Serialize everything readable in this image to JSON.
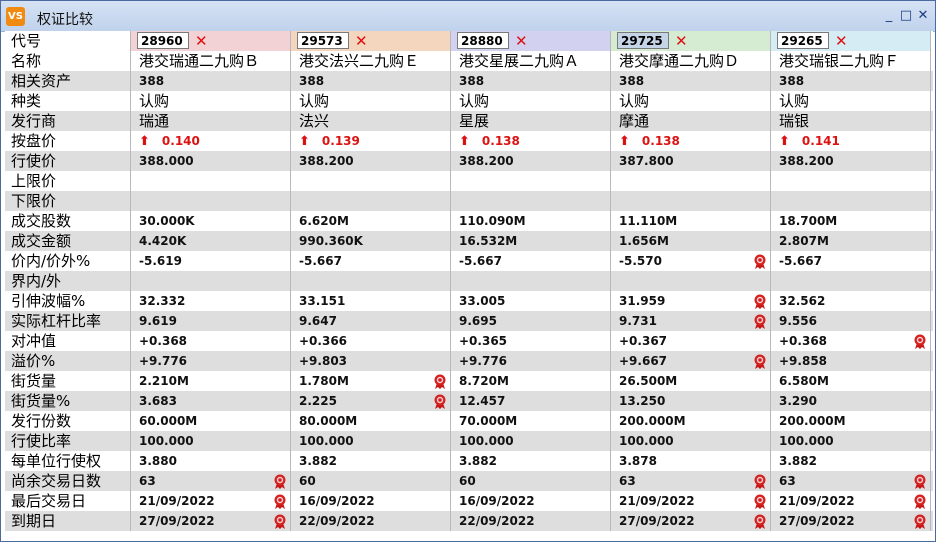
{
  "window": {
    "title": "权证比较",
    "app_icon": "VS",
    "btn_min": "_",
    "btn_max": "□",
    "btn_close": "✕"
  },
  "rows": [
    {
      "label": "代号",
      "kind": "code",
      "values": [
        "28960",
        "29573",
        "28880",
        "29725",
        "29265"
      ]
    },
    {
      "label": "名称",
      "kind": "cjk",
      "values": [
        "港交瑞通二九购Ｂ",
        "港交法兴二九购Ｅ",
        "港交星展二九购Ａ",
        "港交摩通二九购Ｄ",
        "港交瑞银二九购Ｆ"
      ]
    },
    {
      "label": "相关资产",
      "kind": "val",
      "values": [
        "388",
        "388",
        "388",
        "388",
        "388"
      ]
    },
    {
      "label": "种类",
      "kind": "cjk",
      "values": [
        "认购",
        "认购",
        "认购",
        "认购",
        "认购"
      ]
    },
    {
      "label": "发行商",
      "kind": "cjk",
      "values": [
        "瑞通",
        "法兴",
        "星展",
        "摩通",
        "瑞银"
      ]
    },
    {
      "label": "按盘价",
      "kind": "price",
      "values": [
        "0.140",
        "0.139",
        "0.138",
        "0.138",
        "0.141"
      ]
    },
    {
      "label": "行使价",
      "kind": "val",
      "values": [
        "388.000",
        "388.200",
        "388.200",
        "387.800",
        "388.200"
      ]
    },
    {
      "label": "上限价",
      "kind": "val",
      "values": [
        "",
        "",
        "",
        "",
        ""
      ]
    },
    {
      "label": "下限价",
      "kind": "val",
      "values": [
        "",
        "",
        "",
        "",
        ""
      ]
    },
    {
      "label": "成交股数",
      "kind": "val",
      "values": [
        "30.000K",
        "6.620M",
        "110.090M",
        "11.110M",
        "18.700M"
      ]
    },
    {
      "label": "成交金额",
      "kind": "val",
      "values": [
        "4.420K",
        "990.360K",
        "16.532M",
        "1.656M",
        "2.807M"
      ]
    },
    {
      "label": "价内/价外%",
      "kind": "val",
      "values": [
        "-5.619",
        "-5.667",
        "-5.667",
        "-5.570",
        "-5.667"
      ],
      "badges": [
        3
      ]
    },
    {
      "label": "界内/外",
      "kind": "val",
      "values": [
        "",
        "",
        "",
        "",
        ""
      ]
    },
    {
      "label": "引伸波幅%",
      "kind": "val",
      "values": [
        "32.332",
        "33.151",
        "33.005",
        "31.959",
        "32.562"
      ],
      "badges": [
        3
      ]
    },
    {
      "label": "实际杠杆比率",
      "kind": "val",
      "values": [
        "9.619",
        "9.647",
        "9.695",
        "9.731",
        "9.556"
      ],
      "badges": [
        3
      ]
    },
    {
      "label": "对冲值",
      "kind": "val",
      "values": [
        "+0.368",
        "+0.366",
        "+0.365",
        "+0.367",
        "+0.368"
      ],
      "badges": [
        4
      ]
    },
    {
      "label": "溢价%",
      "kind": "val",
      "values": [
        "+9.776",
        "+9.803",
        "+9.776",
        "+9.667",
        "+9.858"
      ],
      "badges": [
        3
      ]
    },
    {
      "label": "街货量",
      "kind": "val",
      "values": [
        "2.210M",
        "1.780M",
        "8.720M",
        "26.500M",
        "6.580M"
      ],
      "badges": [
        1
      ]
    },
    {
      "label": "街货量%",
      "kind": "val",
      "values": [
        "3.683",
        "2.225",
        "12.457",
        "13.250",
        "3.290"
      ],
      "badges": [
        1
      ]
    },
    {
      "label": "发行份数",
      "kind": "val",
      "values": [
        "60.000M",
        "80.000M",
        "70.000M",
        "200.000M",
        "200.000M"
      ]
    },
    {
      "label": "行使比率",
      "kind": "val",
      "values": [
        "100.000",
        "100.000",
        "100.000",
        "100.000",
        "100.000"
      ]
    },
    {
      "label": "每单位行使权",
      "kind": "val",
      "values": [
        "3.880",
        "3.882",
        "3.882",
        "3.878",
        "3.882"
      ]
    },
    {
      "label": "尚余交易日数",
      "kind": "val",
      "values": [
        "63",
        "60",
        "60",
        "63",
        "63"
      ],
      "badges": [
        0,
        3,
        4
      ]
    },
    {
      "label": "最后交易日",
      "kind": "val",
      "values": [
        "21/09/2022",
        "16/09/2022",
        "16/09/2022",
        "21/09/2022",
        "21/09/2022"
      ],
      "badges": [
        0,
        3,
        4
      ]
    },
    {
      "label": "到期日",
      "kind": "val",
      "values": [
        "27/09/2022",
        "22/09/2022",
        "22/09/2022",
        "27/09/2022",
        "27/09/2022"
      ],
      "badges": [
        0,
        3,
        4
      ]
    }
  ],
  "code_colors": [
    "#f2d2d4",
    "#f4d5be",
    "#d2d2f0",
    "#d6ecd2",
    "#d6ecf4"
  ],
  "selected_code_index": 3,
  "icons": {
    "up": "up-arrow-icon",
    "clear": "clear-x-icon",
    "best": "award-ribbon-icon"
  }
}
